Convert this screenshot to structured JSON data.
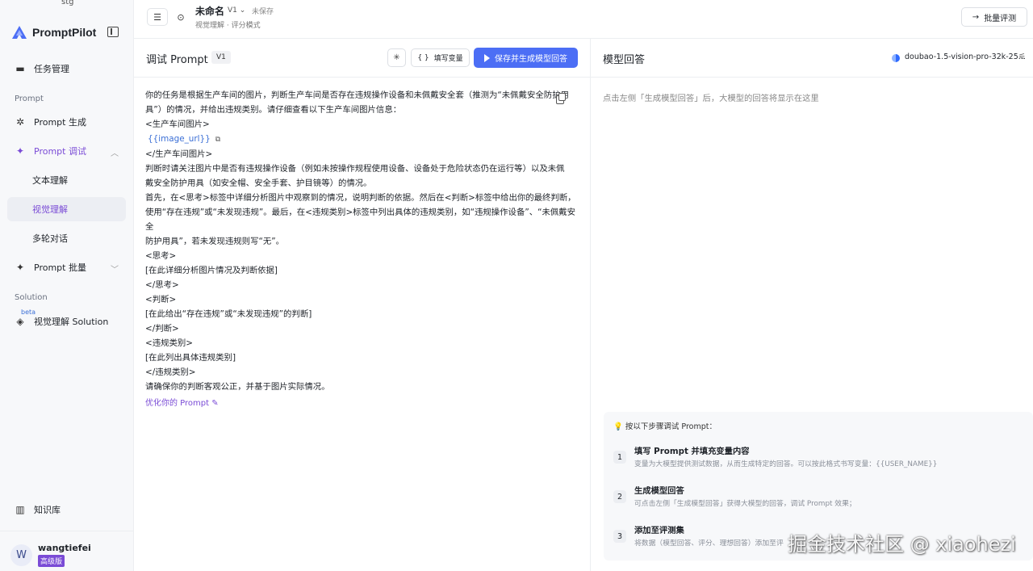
{
  "sidebar": {
    "env": "stg",
    "app_name": "PromptPilot",
    "items": [
      {
        "label": "任务管理"
      },
      {
        "label": "Prompt 生成"
      },
      {
        "label": "Prompt 调试"
      },
      {
        "label": "文本理解"
      },
      {
        "label": "视觉理解"
      },
      {
        "label": "多轮对话"
      },
      {
        "label": "Prompt 批量"
      },
      {
        "label": "视觉理解 Solution"
      },
      {
        "label": "知识库"
      }
    ],
    "section_prompt": "Prompt",
    "section_solution": "Solution",
    "beta": "beta",
    "user": {
      "initial": "W",
      "name": "wangtiefei",
      "plan": "高级版"
    }
  },
  "topbar": {
    "title": "未命名",
    "version": "V1",
    "save_status": "未保存",
    "mode": "视觉理解 · 评分模式",
    "batch_button": "批量评测"
  },
  "prompt_panel": {
    "title": "调试 Prompt",
    "version": "V1",
    "fill_vars": "填写变量",
    "save_generate": "保存并生成模型回答",
    "lines": [
      "你的任务是根据生产车间的图片，判断生产车间是否存在违规操作设备和未佩戴安全套（推测为“未佩戴安全防护用",
      "具”）的情况，并给出违规类别。请仔细查看以下生产车间图片信息：",
      "<生产车间图片>",
      "</生产车间图片>",
      "判断时请关注图片中是否有违规操作设备（例如未按操作规程使用设备、设备处于危险状态仍在运行等）以及未佩",
      "戴安全防护用具（如安全帽、安全手套、护目镜等）的情况。",
      "首先，在<思考>标签中详细分析图片中观察到的情况，说明判断的依据。然后在<判断>标签中给出你的最终判断，",
      "使用“存在违规”或“未发现违规”。最后，在<违规类别>标签中列出具体的违规类别，如“违规操作设备”、“未佩戴安全",
      "防护用具”，若未发现违规则写“无”。",
      "<思考>",
      "[在此详细分析图片情况及判断依据]",
      "</思考>",
      "<判断>",
      "[在此给出“存在违规”或“未发现违规”的判断]",
      "</判断>",
      "<违规类别>",
      "[在此列出具体违规类别]",
      "</违规类别>",
      "请确保你的判断客观公正，并基于图片实际情况。"
    ],
    "variable": "{{image_url}}",
    "optimize": "优化你的 Prompt"
  },
  "response_panel": {
    "title": "模型回答",
    "model": "doubao-1.5-vision-pro-32k-25...",
    "placeholder": "点击左侧「生成模型回答」后，大模型的回答将显示在这里",
    "steps_title": "按以下步骤调试 Prompt：",
    "steps": [
      {
        "num": "1",
        "title": "填写 Prompt 并填充变量内容",
        "desc": "变量为大模型提供测试数据，从而生成特定的回答。可以按此格式书写变量：{{USER_NAME}}"
      },
      {
        "num": "2",
        "title": "生成模型回答",
        "desc": "可点击左侧「生成模型回答」获得大模型的回答，调试 Prompt 效果；"
      },
      {
        "num": "3",
        "title": "添加至评测集",
        "desc": "将数据（模型回答、评分、理想回答）添加至评"
      }
    ]
  },
  "watermark": "掘金技术社区 @ xiaohezi"
}
